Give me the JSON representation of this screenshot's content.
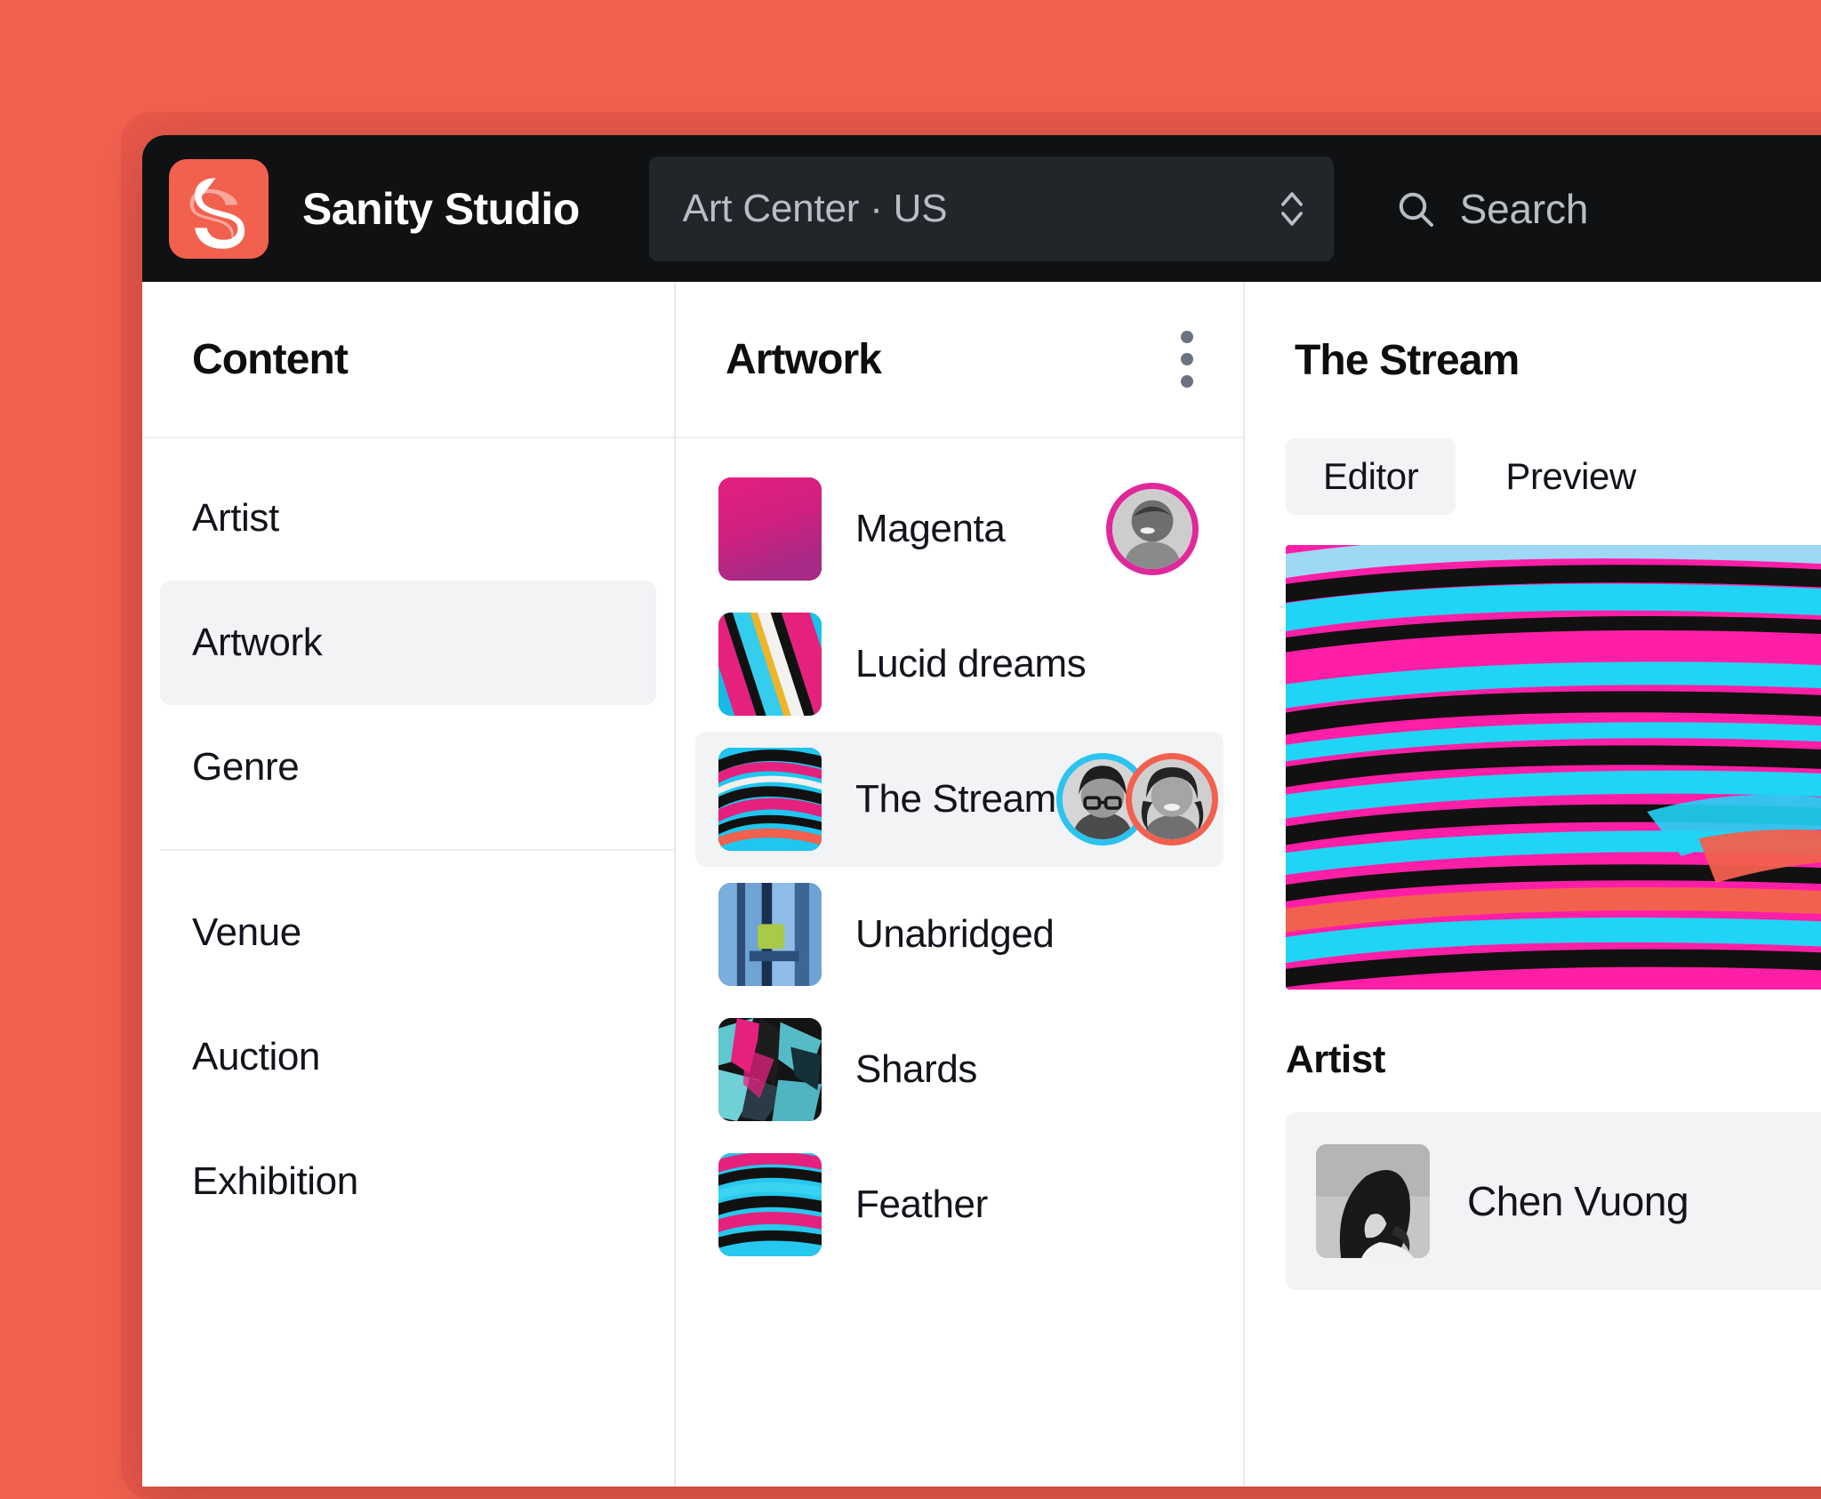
{
  "app": {
    "title": "Sanity Studio",
    "logo_icon": "sanity-s-logo",
    "brand_color": "#f2604e",
    "navbar_bg": "#101112"
  },
  "navbar": {
    "workspace": {
      "label": "Art Center · US",
      "chevron_icon": "chevron-up-down-icon"
    },
    "search": {
      "icon": "search-icon",
      "placeholder": "Search"
    }
  },
  "content_pane": {
    "title": "Content",
    "items": [
      {
        "label": "Artist",
        "selected": false,
        "separator_after": false
      },
      {
        "label": "Artwork",
        "selected": true,
        "separator_after": false
      },
      {
        "label": "Genre",
        "selected": false,
        "separator_after": true
      },
      {
        "label": "Venue",
        "selected": false,
        "separator_after": false
      },
      {
        "label": "Auction",
        "selected": false,
        "separator_after": false
      },
      {
        "label": "Exhibition",
        "selected": false,
        "separator_after": false
      }
    ]
  },
  "artwork_pane": {
    "title": "Artwork",
    "menu_icon": "kebab-menu-icon",
    "items": [
      {
        "label": "Magenta",
        "selected": false,
        "thumb": "magenta-gradient",
        "avatars": [
          {
            "ring": "#e0289b",
            "name": "avatar-laughing-man"
          }
        ]
      },
      {
        "label": "Lucid dreams",
        "selected": false,
        "thumb": "lucid-stripes",
        "avatars": []
      },
      {
        "label": "The Stream",
        "selected": true,
        "thumb": "stream-swirl",
        "avatars": [
          {
            "ring": "#2cc3ef",
            "name": "avatar-woman-glasses"
          },
          {
            "ring": "#f2604e",
            "name": "avatar-smiling-woman"
          }
        ]
      },
      {
        "label": "Unabridged",
        "selected": false,
        "thumb": "unabridged-blue",
        "avatars": []
      },
      {
        "label": "Shards",
        "selected": false,
        "thumb": "shards-teal",
        "avatars": []
      },
      {
        "label": "Feather",
        "selected": false,
        "thumb": "feather-waves",
        "avatars": []
      }
    ]
  },
  "document_pane": {
    "title": "The Stream",
    "tabs": [
      {
        "label": "Editor",
        "active": true
      },
      {
        "label": "Preview",
        "active": false
      }
    ],
    "hero_image": "the-stream-artwork",
    "artist_field": {
      "label": "Artist",
      "value": "Chen Vuong",
      "thumb": "chen-vuong-portrait"
    }
  }
}
